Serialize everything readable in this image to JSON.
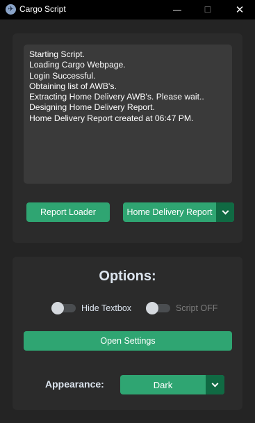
{
  "window": {
    "title": "Cargo Script",
    "icon": "airplane-icon",
    "controls": {
      "minimize": "—",
      "maximize": "☐",
      "close": "✕"
    }
  },
  "log": {
    "lines": [
      "Starting Script.",
      "Loading Cargo Webpage.",
      "Login Successful.",
      "Obtaining list of AWB's.",
      "Extracting Home Delivery AWB's. Please wait..",
      "Designing Home Delivery Report.",
      "Home Delivery Report created at 06:47 PM."
    ]
  },
  "actions": {
    "report_loader_label": "Report Loader",
    "report_menu_value": "Home Delivery Report"
  },
  "options": {
    "title": "Options:",
    "hide_textbox_label": "Hide Textbox",
    "hide_textbox_on": false,
    "script_label": "Script OFF",
    "script_on": false,
    "open_settings_label": "Open Settings",
    "appearance_label": "Appearance:",
    "appearance_value": "Dark"
  },
  "colors": {
    "accent": "#2fa572",
    "accent_dark": "#106a43",
    "background": "#242424",
    "panel": "#2b2b2b",
    "textbox": "#3a3a3a"
  }
}
